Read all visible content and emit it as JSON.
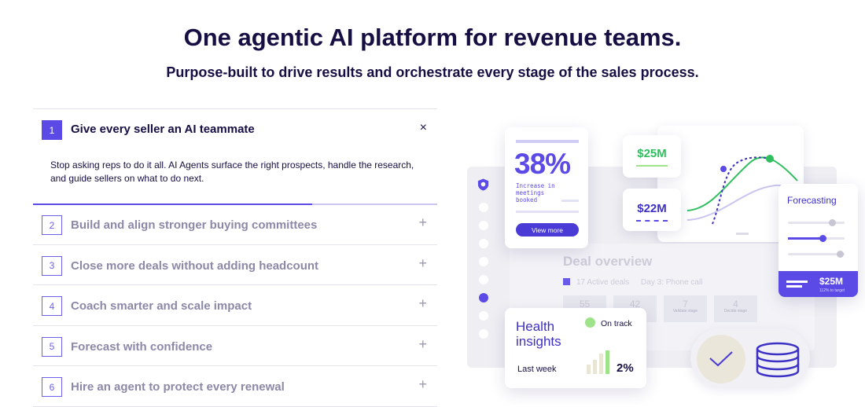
{
  "hero": {
    "title": "One agentic AI platform for revenue teams.",
    "subtitle": "Purpose-built to drive results and orchestrate every stage of the sales process."
  },
  "accordion": {
    "open": {
      "number": "1",
      "title": "Give every seller an AI teammate",
      "body": "Stop asking reps to do it all. AI Agents surface the right prospects, handle the research, and guide sellers on what to do next.",
      "close_icon": "×",
      "progress": 0.69
    },
    "items": [
      {
        "number": "2",
        "title": "Build and align stronger buying committees"
      },
      {
        "number": "3",
        "title": "Close more deals without adding headcount"
      },
      {
        "number": "4",
        "title": "Coach smarter and scale impact"
      },
      {
        "number": "5",
        "title": "Forecast with confidence"
      },
      {
        "number": "6",
        "title": "Hire an agent to protect every renewal"
      }
    ],
    "plus_icon": "+"
  },
  "illustration": {
    "stat": {
      "value": "38%",
      "description": "Increase in meetings booked",
      "button": "View more"
    },
    "money_top": "$25M",
    "money_bottom": "$22M",
    "deal": {
      "title": "Deal overview",
      "legend_a": "17 Active deals",
      "legend_b": "Day 3: Phone call",
      "stages": [
        {
          "value": "55",
          "label": ""
        },
        {
          "value": "42",
          "label": ""
        },
        {
          "value": "7",
          "label": "Validate stage"
        },
        {
          "value": "4",
          "label": "Decide stage"
        }
      ]
    },
    "forecast": {
      "title": "Forecasting",
      "value": "$25M",
      "sub": "112% to target"
    },
    "health": {
      "title": "Health insights",
      "status": "On track",
      "period": "Last week",
      "pct": "2%"
    },
    "colors": {
      "accent": "#5b4ae6",
      "green": "#2fbf5f",
      "status_green": "#9ee389",
      "navy": "#160f44"
    },
    "icons": [
      "shield-icon",
      "check-icon",
      "database-icon"
    ]
  }
}
